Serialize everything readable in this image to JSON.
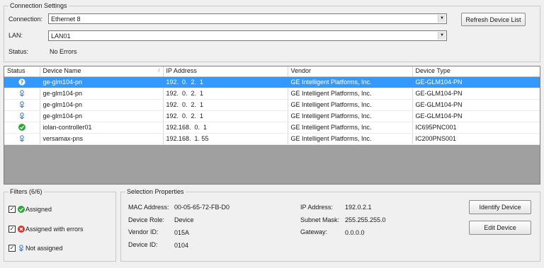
{
  "connection_settings": {
    "title": "Connection Settings",
    "connection_label": "Connection:",
    "connection_value": "Ethernet 8",
    "lan_label": "LAN:",
    "lan_value": "LAN01",
    "status_label": "Status:",
    "status_value": "No Errors",
    "refresh_button": "Refresh Device List"
  },
  "device_table": {
    "columns": [
      "Status",
      "Device Name",
      "IP Address",
      "Vendor",
      "Device Type"
    ],
    "rows": [
      {
        "status_icon": "unknown-question-icon",
        "name": "ge-glm104-pn",
        "ip": "192.  0.  2.  1",
        "vendor": "GE Intelligent Platforms, Inc.",
        "type": "GE-GLM104-PN",
        "selected": true
      },
      {
        "status_icon": "not-assigned-icon",
        "name": "ge-glm104-pn",
        "ip": "192.  0.  2.  1",
        "vendor": "GE Intelligent Platforms, Inc.",
        "type": "GE-GLM104-PN",
        "selected": false
      },
      {
        "status_icon": "not-assigned-icon",
        "name": "ge-glm104-pn",
        "ip": "192.  0.  2.  1",
        "vendor": "GE Intelligent Platforms, Inc.",
        "type": "GE-GLM104-PN",
        "selected": false
      },
      {
        "status_icon": "not-assigned-icon",
        "name": "ge-glm104-pn",
        "ip": "192.  0.  2.  1",
        "vendor": "GE Intelligent Platforms, Inc.",
        "type": "GE-GLM104-PN",
        "selected": false
      },
      {
        "status_icon": "assigned-check-icon",
        "name": "iolan-controller01",
        "ip": "192.168.  0.  1",
        "vendor": "GE Intelligent Platforms, Inc.",
        "type": "IC695PNC001",
        "selected": false
      },
      {
        "status_icon": "not-assigned-icon",
        "name": "versamax-pns",
        "ip": "192.168.  1. 55",
        "vendor": "GE Intelligent Platforms, Inc.",
        "type": "IC200PNS001",
        "selected": false
      }
    ]
  },
  "filters": {
    "title": "Filters  (6/6)",
    "items": [
      {
        "label": "Assigned",
        "checked": "✓",
        "icon": "assigned-check-icon"
      },
      {
        "label": "Assigned with errors",
        "checked": "✓",
        "icon": "error-x-icon"
      },
      {
        "label": "Not assigned",
        "checked": "✓",
        "icon": "not-assigned-icon"
      }
    ]
  },
  "selection_properties": {
    "title": "Selection Properties",
    "mac_label": "MAC Address:",
    "mac_value": "00-05-65-72-FB-D0",
    "role_label": "Device Role:",
    "role_value": "Device",
    "vendor_id_label": "Vendor ID:",
    "vendor_id_value": "015A",
    "device_id_label": "Device ID:",
    "device_id_value": "0104",
    "ip_label": "IP Address:",
    "ip_value": "192.0.2.1",
    "subnet_label": "Subnet Mask:",
    "subnet_value": "255.255.255.0",
    "gateway_label": "Gateway:",
    "gateway_value": "0.0.0.0",
    "identify_button": "Identify Device",
    "edit_button": "Edit Device"
  },
  "colors": {
    "selection": "#3399ff",
    "assigned": "#2aa836",
    "error": "#d9302c",
    "not_assigned": "#2c6fbf"
  }
}
